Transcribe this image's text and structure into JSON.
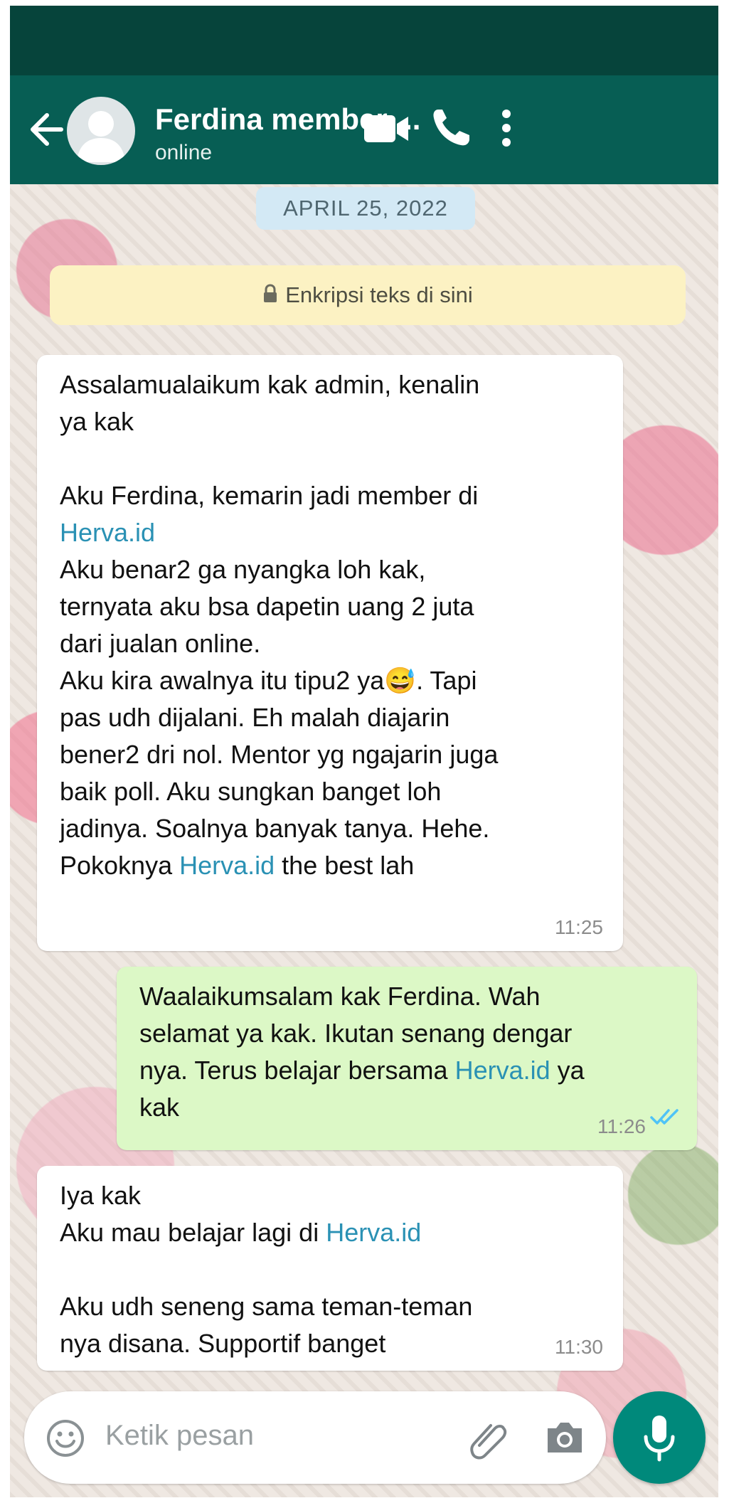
{
  "header": {
    "title": "Ferdina member ...",
    "status": "online",
    "icons": [
      "back-arrow-icon",
      "avatar",
      "video-call-icon",
      "phone-icon",
      "more-options-icon"
    ]
  },
  "chat": {
    "date_chip": "APRIL 25, 2022",
    "encryption_notice": "Enkripsi teks di sini",
    "messages": [
      {
        "direction": "incoming",
        "time": "11:25",
        "lines": {
          "l1": "Assalamualaikum kak admin, kenalin",
          "l2": "ya kak",
          "l3": "Aku Ferdina, kemarin jadi member di",
          "link1": "Herva.id",
          "l4": "Aku benar2 ga nyangka loh kak,",
          "l5": "ternyata aku bsa dapetin uang 2 juta",
          "l6": "dari jualan online.",
          "l7a": "Aku kira awalnya itu tipu2 ya",
          "emoji": "😅",
          "l7b": ". Tapi",
          "l8": "pas udh dijalani. Eh malah diajarin",
          "l9": "bener2 dri nol. Mentor yg ngajarin juga",
          "l10": "baik poll. Aku sungkan banget loh",
          "l11": "jadinya. Soalnya banyak tanya. Hehe.",
          "l12a": "Pokoknya ",
          "link2": "Herva.id",
          "l12b": " the best lah"
        }
      },
      {
        "direction": "outgoing",
        "time": "11:26",
        "read_status": "read",
        "lines": {
          "l1": "Waalaikumsalam kak Ferdina. Wah",
          "l2": "selamat ya kak. Ikutan senang dengar",
          "l3a": "nya. Terus belajar bersama ",
          "link": "Herva.id",
          "l3b": " ya",
          "l4": "kak"
        }
      },
      {
        "direction": "incoming",
        "time": "11:30",
        "lines": {
          "l1": "Iya kak",
          "l2a": "Aku mau belajar lagi di ",
          "link": "Herva.id",
          "l3": "Aku udh seneng sama teman-teman",
          "l4": "nya disana. Supportif banget"
        }
      }
    ]
  },
  "composer": {
    "placeholder": "Ketik pesan",
    "icons": [
      "emoji-icon",
      "attach-icon",
      "camera-icon",
      "mic-icon"
    ]
  },
  "colors": {
    "header": "#075e54",
    "statusbar": "#06443b",
    "outgoing_bubble": "#dcf8c6",
    "incoming_bubble": "#ffffff",
    "link": "#2a91b4",
    "mic_button": "#00897b",
    "read_ticks": "#4fc3f7"
  }
}
